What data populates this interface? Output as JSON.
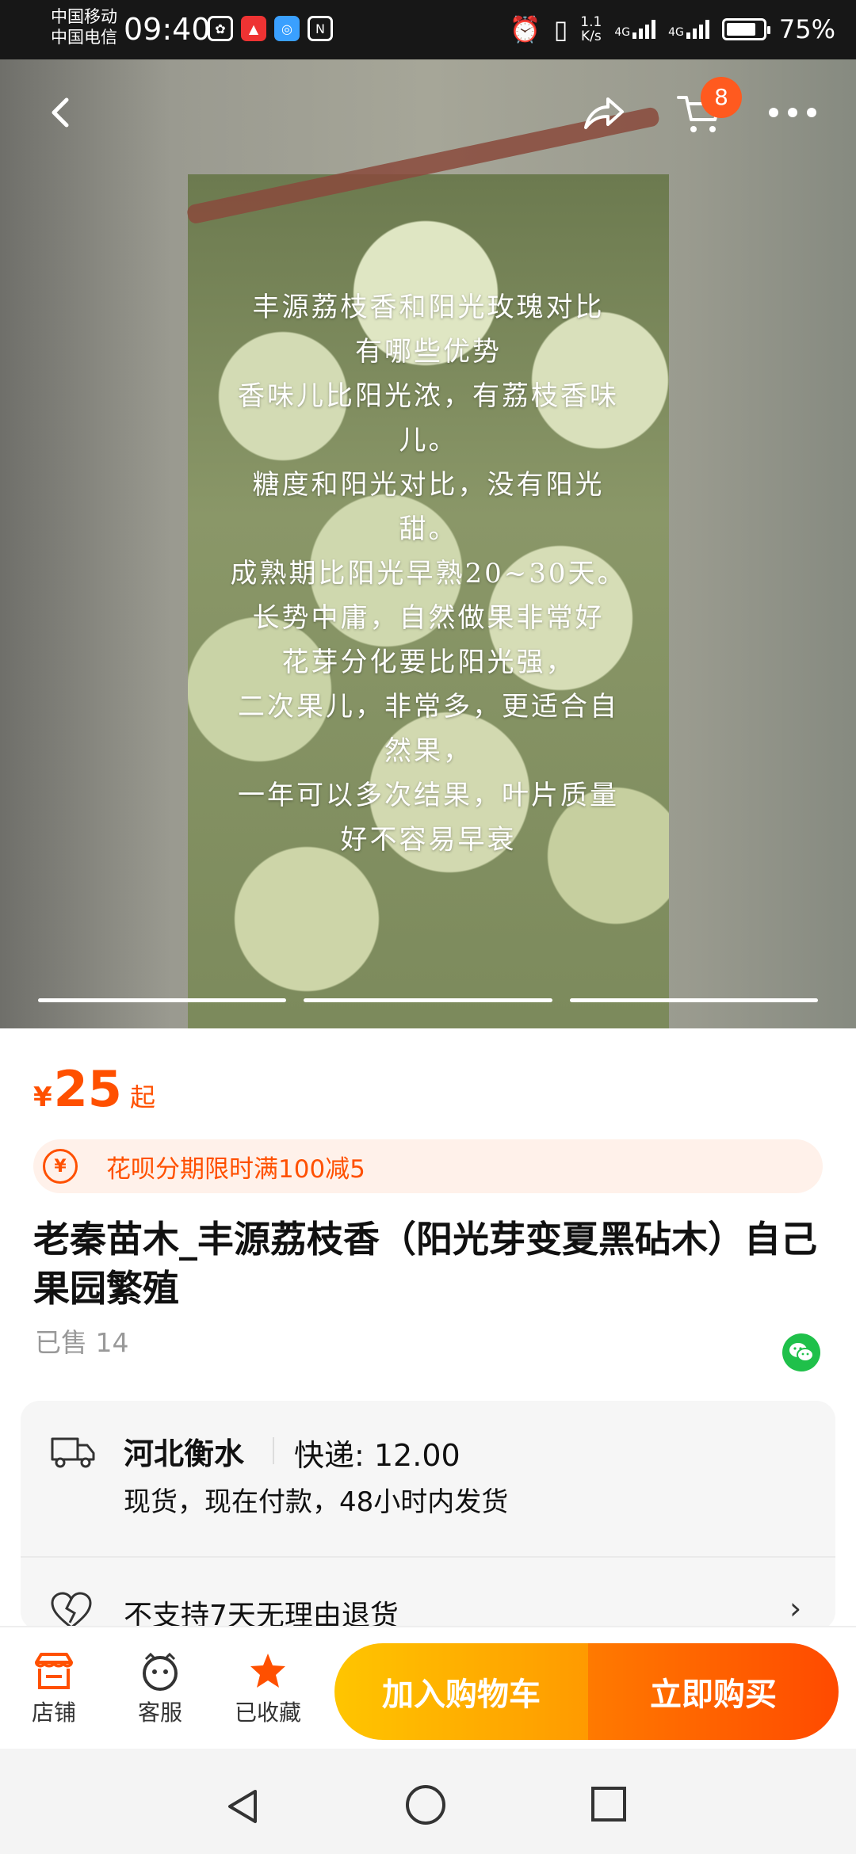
{
  "status_bar": {
    "carrier_1": "中国移动",
    "carrier_2": "中国电信",
    "time": "09:40",
    "net_speed_value": "1.1",
    "net_speed_unit": "K/s",
    "signal_1": "4G",
    "signal_2": "4G",
    "battery": "75%"
  },
  "gallery": {
    "cart_count": "8",
    "overlay_lines": [
      "丰源荔枝香和阳光玫瑰对比",
      "有哪些优势",
      "香味儿比阳光浓，有荔枝香味",
      "儿。",
      "糖度和阳光对比，没有阳光",
      "甜。",
      "成熟期比阳光早熟20~30天。",
      "长势中庸，自然做果非常好",
      "花芽分化要比阳光强，",
      "二次果儿，非常多，更适合自",
      "然果，",
      "一年可以多次结果，叶片质量",
      "好不容易早衰"
    ]
  },
  "product": {
    "currency": "¥",
    "price": "25",
    "price_suffix": "起",
    "promo": "花呗分期限时满100减5",
    "title": "老秦苗木_丰源荔枝香（阳光芽变夏黑砧木）自己果园繁殖",
    "sold": "已售 14"
  },
  "shipping": {
    "origin": "河北衡水",
    "express": "快递: 12.00",
    "dispatch": "现货，现在付款，48小时内发货",
    "refund": "不支持7天无理由退货"
  },
  "actions": {
    "store": "店铺",
    "service": "客服",
    "favorited": "已收藏",
    "add_to_cart": "加入购物车",
    "buy_now": "立即购买"
  },
  "colors": {
    "accent": "#ff5000",
    "cart_button": "#ffb000",
    "buy_button": "#ff5a00"
  }
}
